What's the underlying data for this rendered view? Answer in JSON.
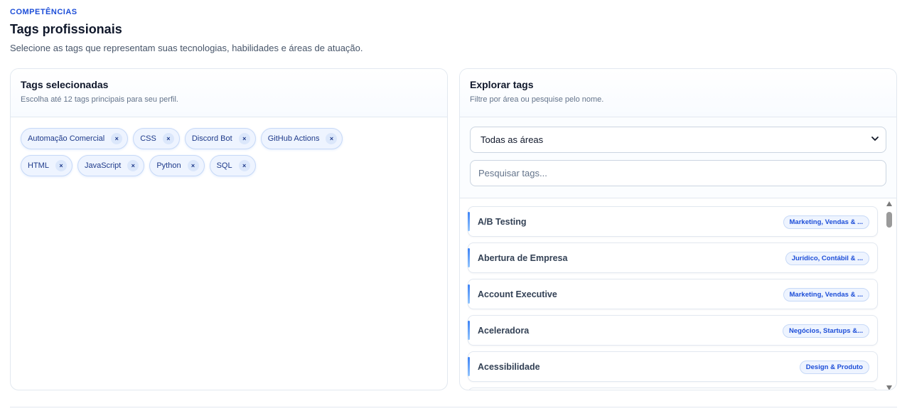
{
  "header": {
    "eyebrow": "COMPETÊNCIAS",
    "title": "Tags profissionais",
    "subtitle": "Selecione as tags que representam suas tecnologias, habilidades e áreas de atuação."
  },
  "selected": {
    "title": "Tags selecionadas",
    "description": "Escolha até 12 tags principais para seu perfil.",
    "remove_symbol": "×",
    "tags": [
      {
        "label": "Automação Comercial"
      },
      {
        "label": "CSS"
      },
      {
        "label": "Discord Bot"
      },
      {
        "label": "GitHub Actions"
      },
      {
        "label": "HTML"
      },
      {
        "label": "JavaScript"
      },
      {
        "label": "Python"
      },
      {
        "label": "SQL"
      }
    ]
  },
  "explore": {
    "title": "Explorar tags",
    "description": "Filtre por área ou pesquise pelo nome.",
    "area_select": {
      "value": "Todas as áreas"
    },
    "search": {
      "placeholder": "Pesquisar tags..."
    },
    "items": [
      {
        "name": "A/B Testing",
        "area": "Marketing, Vendas & ..."
      },
      {
        "name": "Abertura de Empresa",
        "area": "Jurídico, Contábil & ..."
      },
      {
        "name": "Account Executive",
        "area": "Marketing, Vendas & ..."
      },
      {
        "name": "Aceleradora",
        "area": "Negócios, Startups &..."
      },
      {
        "name": "Acessibilidade",
        "area": "Design & Produto"
      }
    ]
  },
  "colors": {
    "accent": "#1d4ed8",
    "chip_bg": "#eef4ff",
    "border": "#e2e8f0"
  }
}
